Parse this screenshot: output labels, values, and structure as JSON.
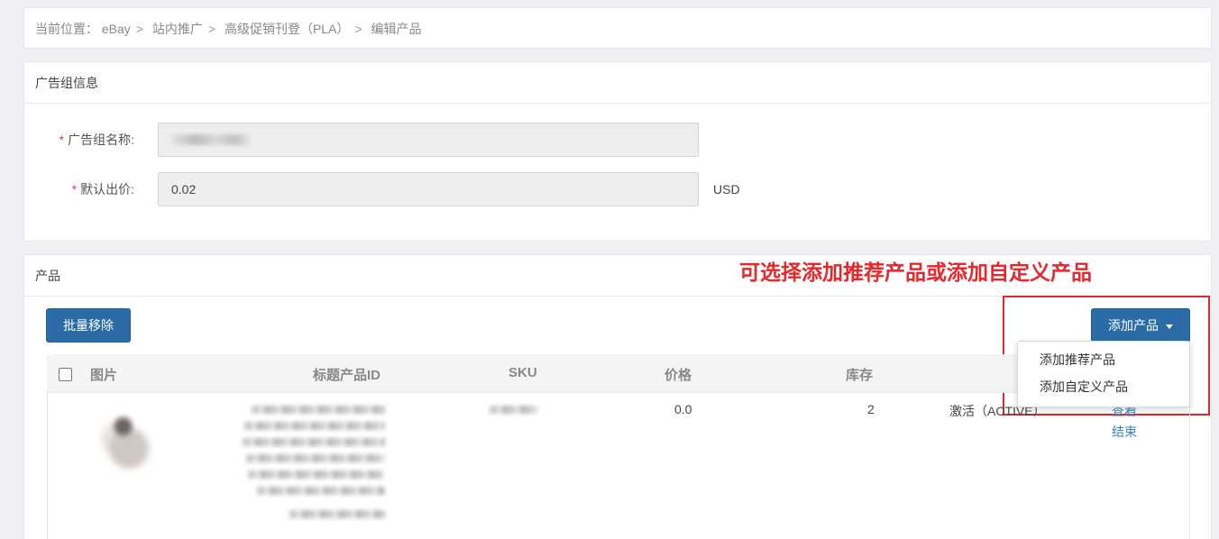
{
  "breadcrumb": {
    "prefix": "当前位置：",
    "items": [
      "eBay",
      "站内推广",
      "高级促销刊登（PLA）",
      "编辑产品"
    ]
  },
  "adgroup": {
    "title": "广告组信息",
    "name_label": "广告组名称:",
    "bid_label": "默认出价:",
    "bid_value": "0.02",
    "currency": "USD",
    "required_mark": "*"
  },
  "products": {
    "title": "产品",
    "annotation": "可选择添加推荐产品或添加自定义产品",
    "batch_remove": "批量移除",
    "add_product": "添加产品",
    "dropdown": [
      "添加推荐产品",
      "添加自定义产品"
    ],
    "columns": [
      "图片",
      "标题产品ID",
      "SKU",
      "价格",
      "库存"
    ],
    "rows": [
      {
        "price": "0.0",
        "stock": "2",
        "status": "激活（ACTIVE）",
        "actions": [
          "查看",
          "结束"
        ]
      }
    ]
  },
  "colors": {
    "primary": "#2b6ca7",
    "annotation_red": "#e8272b",
    "link": "#3a7fc1"
  }
}
